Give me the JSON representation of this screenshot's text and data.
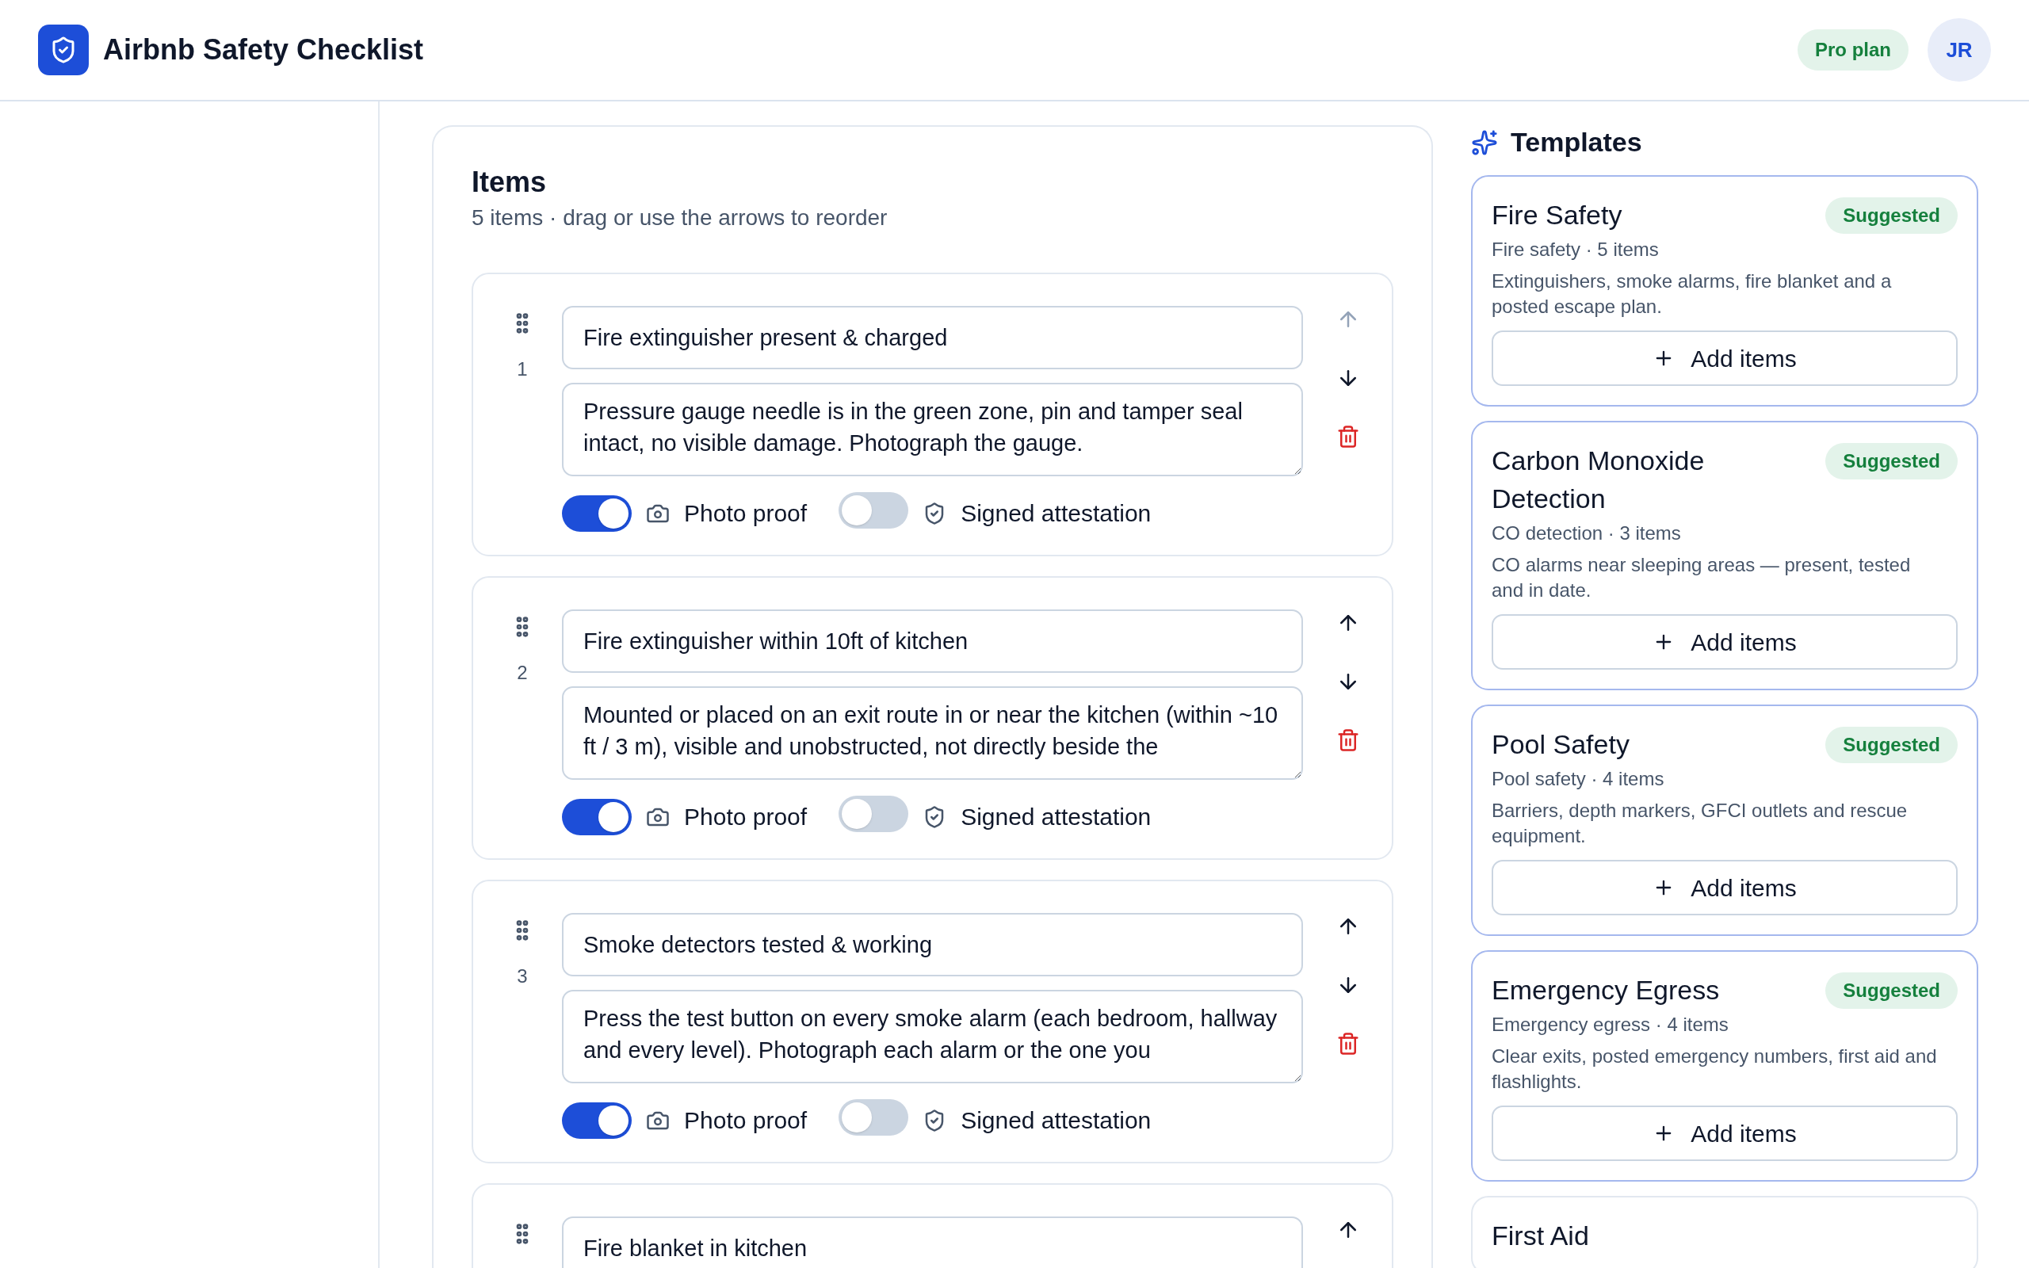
{
  "header": {
    "title": "Airbnb Safety Checklist",
    "plan_badge": "Pro plan",
    "avatar_initials": "JR"
  },
  "items_panel": {
    "heading": "Items",
    "subtitle": "5 items · drag or use the arrows to reorder",
    "items": [
      {
        "number": "1",
        "title": "Fire extinguisher present & charged",
        "description": "Pressure gauge needle is in the green zone, pin and tamper seal intact, no visible damage. Photograph the gauge.",
        "photo_label": "Photo proof",
        "photo_proof": true,
        "attestation_label": "Signed attestation",
        "signed_attestation": false,
        "up_disabled": true
      },
      {
        "number": "2",
        "title": "Fire extinguisher within 10ft of kitchen",
        "description": "Mounted or placed on an exit route in or near the kitchen (within ~10 ft / 3 m), visible and unobstructed, not directly beside the",
        "photo_label": "Photo proof",
        "photo_proof": true,
        "attestation_label": "Signed attestation",
        "signed_attestation": false,
        "up_disabled": false
      },
      {
        "number": "3",
        "title": "Smoke detectors tested & working",
        "description": "Press the test button on every smoke alarm (each bedroom, hallway and every level). Photograph each alarm or the one you",
        "photo_label": "Photo proof",
        "photo_proof": true,
        "attestation_label": "Signed attestation",
        "signed_attestation": false,
        "up_disabled": false
      },
      {
        "title": "Fire blanket in kitchen",
        "up_disabled": false
      }
    ]
  },
  "templates": {
    "heading": "Templates",
    "cards": [
      {
        "title": "Fire Safety",
        "badge": "Suggested",
        "meta": "Fire safety · 5 items",
        "description": "Extinguishers, smoke alarms, fire blanket and a posted escape plan.",
        "button": "Add items",
        "highlighted": true
      },
      {
        "title": "Carbon Monoxide Detection",
        "badge": "Suggested",
        "meta": "CO detection · 3 items",
        "description": "CO alarms near sleeping areas — present, tested and in date.",
        "button": "Add items",
        "highlighted": true
      },
      {
        "title": "Pool Safety",
        "badge": "Suggested",
        "meta": "Pool safety · 4 items",
        "description": "Barriers, depth markers, GFCI outlets and rescue equipment.",
        "button": "Add items",
        "highlighted": true
      },
      {
        "title": "Emergency Egress",
        "badge": "Suggested",
        "meta": "Emergency egress · 4 items",
        "description": "Clear exits, posted emergency numbers, first aid and flashlights.",
        "button": "Add items",
        "highlighted": true
      },
      {
        "title": "First Aid",
        "highlighted": false
      }
    ]
  }
}
